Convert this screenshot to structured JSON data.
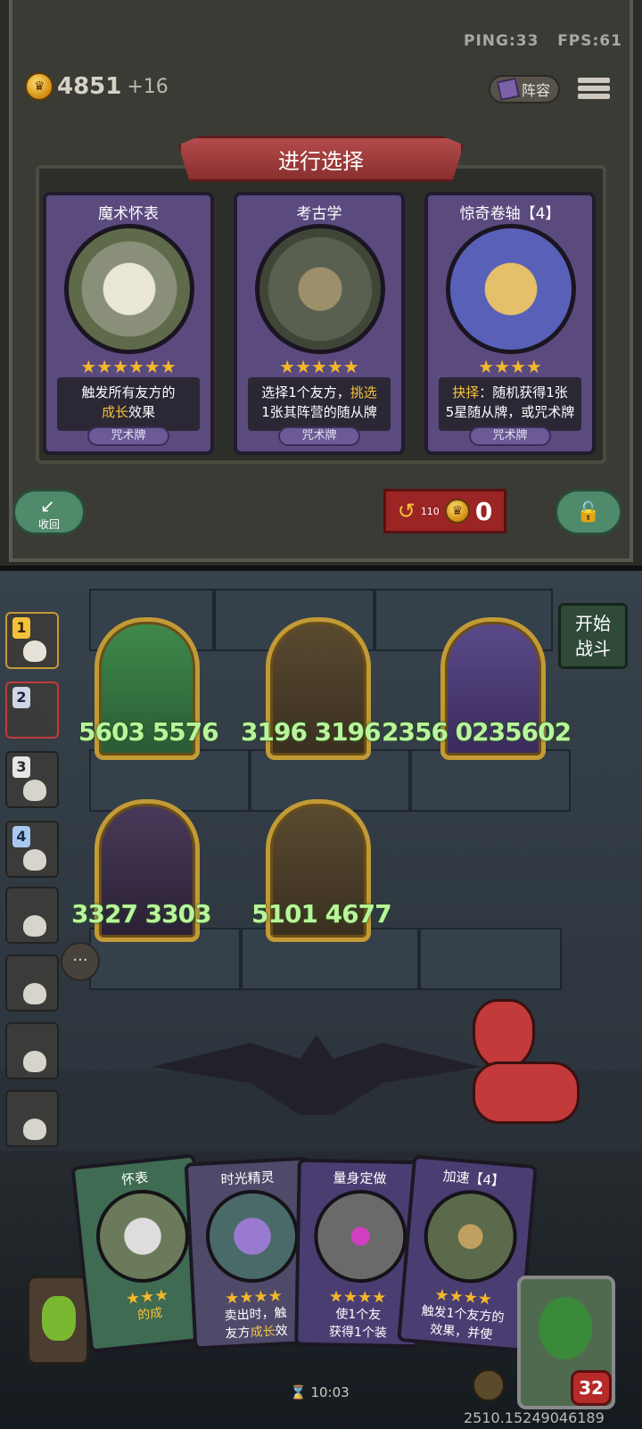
{
  "hud": {
    "ping": "PING:33",
    "fps": "FPS:61"
  },
  "gold": {
    "amount": "4851",
    "income": "+16"
  },
  "lineup_label": "阵容",
  "select_title": "进行选择",
  "choices": [
    {
      "title": "魔术怀表",
      "desc_a": "触发所有友方的",
      "desc_hl": "成长",
      "desc_b": "效果",
      "type": "咒术牌",
      "stars": "★★★★★★"
    },
    {
      "title": "考古学",
      "desc_a": "选择1个友方，",
      "desc_hl": "挑选",
      "desc_b": "1张其阵营的随从牌",
      "type": "咒术牌",
      "stars": "★★★★★"
    },
    {
      "title": "惊奇卷轴【4】",
      "desc_hl": "抉择",
      "desc_a": "：随机获得1张",
      "desc_b": "5星随从牌，或咒术牌",
      "type": "咒术牌",
      "stars": "★★★★"
    }
  ],
  "collapse_label": "收回",
  "refresh": {
    "sub": "110",
    "cost": "0"
  },
  "start_battle": {
    "line1": "开始",
    "line2": "战斗"
  },
  "sidebar_slots": [
    {
      "num": "1",
      "color": "#f3c13a"
    },
    {
      "num": "2",
      "color": "#cfd6e6"
    },
    {
      "num": "3",
      "color": "#e6e6e6"
    },
    {
      "num": "4",
      "color": "#a8c8f0"
    }
  ],
  "heroes": [
    {
      "stats": "5603 5576"
    },
    {
      "stats": "3196 3196"
    },
    {
      "stats": "2356 0235602"
    },
    {
      "stats": "3327 3303"
    },
    {
      "stats": "5101 4677"
    }
  ],
  "hand": [
    {
      "title": "怀表",
      "desc": "的成",
      "color": "#3e6b52"
    },
    {
      "title": "时光精灵",
      "desc_a": "卖出时，触",
      "desc_b": "友方",
      "desc_hl": "成长",
      "desc_c": "效",
      "color": "#4f4a6a"
    },
    {
      "title": "量身定做",
      "desc_a": "使1个友",
      "desc_b": "获得1个装",
      "color": "#4a3d72"
    },
    {
      "title": "加速【4】",
      "desc_a": "触发1个友方的",
      "desc_b": "效果，并使",
      "color": "#4a3d72"
    }
  ],
  "timer": "10:03",
  "hp": "32",
  "coords": "2510.15249046189",
  "colors": {
    "accent_gold": "#f3c13a",
    "stat_green": "#b8f59a",
    "banner_red": "#b34b4b"
  }
}
